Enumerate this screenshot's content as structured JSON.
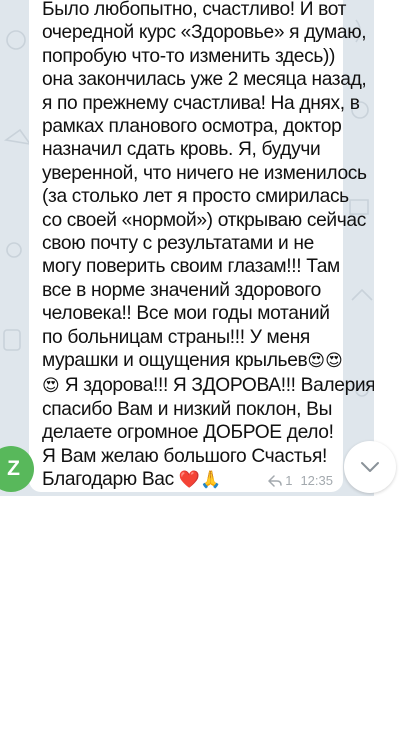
{
  "message": {
    "lines": [
      "Было любопытно, счастливо! И вот",
      "очередной курс «Здоровье» я думаю,",
      "попробую что-то изменить здесь))",
      "она закончилась уже 2 месяца назад,",
      "я по прежнему счастлива! На днях, в",
      "рамках планового осмотра, доктор",
      "назначил сдать кровь. Я, будучи",
      "уверенной, что ничего не изменилось",
      "(за столько лет я просто смирилась",
      "со своей «нормой») открываю сейчас",
      "свою почту с результатами и не",
      "могу поверить своим глазам!!! Там",
      "все в норме значений здорового",
      "человека!! Все мои годы мотаний",
      "по больницам страны!!! У меня",
      "мурашки и ощущения крыльев",
      " Я здорова!!! Я ЗДОРОВА!!! Валерия,",
      "спасибо Вам и низкий поклон, Вы",
      "делаете огромное ДОБРОЕ дело!",
      "Я Вам желаю большого Счастья!",
      "Благодарю Вас "
    ],
    "emoji_after_line_16": "😍😍",
    "emoji_before_line_17": "😍",
    "emoji_after_line_21": "❤️🙏",
    "reply_count": "1",
    "time": "12:35"
  },
  "sender": {
    "avatar_letter": "Z",
    "avatar_color": "#58b85b"
  },
  "colors": {
    "chat_background": "#dfe6ec",
    "bubble": "#ffffff",
    "meta_text": "#a3a9ae"
  },
  "icons": {
    "reply": "reply-arrow-icon",
    "scroll": "chevron-down-icon"
  }
}
